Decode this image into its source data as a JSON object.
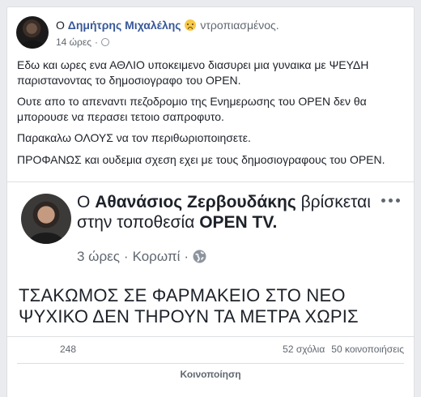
{
  "post": {
    "author_prefix": "Ο",
    "author": "Δημήτρης Μιχαλέλης",
    "feeling_icon": "sad-face-emoji",
    "feeling": "ντροπιασμένος.",
    "time": "14 ώρες",
    "dot": "·",
    "paragraphs": [
      "Εδω και ωρες ενα ΑΘΛΙΟ υποκειμενο διασυρει μια γυναικα με ΨΕΥΔΗ παριστανοντας το δημοσιογραφο του OPEN.",
      "Ουτε απο το απεναντι πεζοδρομιο της Ενημερωσης του OPEN δεν θα μπορουσε να περασει τετοιο σαπροφυτο.",
      "Παρακαλω ΟΛΟΥΣ να τον περιθωριοποιησετε.",
      "ΠΡΟΦΑΝΩΣ και ουδεμια σχεση εχει με τους δημοσιογραφους του OPEN."
    ]
  },
  "shared": {
    "author_prefix": "Ο",
    "author": "Αθανάσιος Ζερβουδάκης",
    "location_text": "βρίσκεται στην τοποθεσία",
    "location": "OPEN TV.",
    "time": "3 ώρες",
    "dot": "·",
    "place": "Κορωπί",
    "dot2": "·",
    "text": "ΤΣΑΚΩΜΟΣ ΣΕ ΦΑΡΜΑΚΕΙΟ ΣΤΟ ΝΕΟ ΨΥΧΙΚΟ  ΔΕΝ ΤΗΡΟΥΝ ΤΑ ΜΕΤΡΑ ΧΩΡΙΣ"
  },
  "stats": {
    "likes": "248",
    "comments": "52 σχόλια",
    "shares": "50 κοινοποιήσεις"
  },
  "actions": {
    "share": "Κοινοποίηση"
  },
  "colors": {
    "link_blue": "#385898",
    "text": "#1d2129",
    "secondary": "#606770",
    "page_bg": "#e9ebee"
  }
}
